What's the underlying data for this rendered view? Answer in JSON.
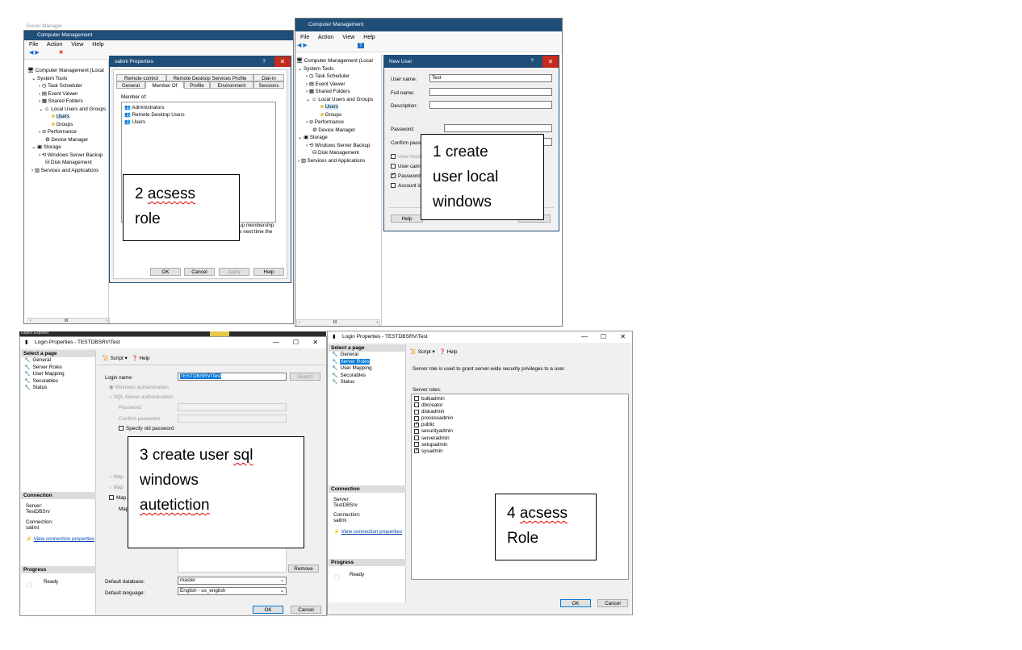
{
  "cm_left": {
    "faded_title": "Server Manager",
    "title": "Computer Management",
    "menu": [
      "File",
      "Action",
      "View",
      "Help"
    ],
    "tree": [
      "Computer Management (Local",
      "System Tools",
      "Task Scheduler",
      "Event Viewer",
      "Shared Folders",
      "Local Users and Groups",
      "Users",
      "Groups",
      "Performance",
      "Device Manager",
      "Storage",
      "Windows Server Backup",
      "Disk Management",
      "Services and Applications"
    ]
  },
  "salimi_dialog": {
    "title": "salimi Properties",
    "tabs_row1": [
      "Remote control",
      "Remote Desktop Services Profile",
      "Dial-in"
    ],
    "tabs_row2": [
      "General",
      "Member Of",
      "Profile",
      "Environment",
      "Sessions"
    ],
    "member_of_label": "Member of:",
    "members": [
      "Administrators",
      "Remote Desktop Users",
      "Users"
    ],
    "note_line1": "up membership",
    "note_line2": "e next time the",
    "buttons": [
      "OK",
      "Cancel",
      "Apply",
      "Help"
    ]
  },
  "cm_right": {
    "title": "Computer Management",
    "menu": [
      "File",
      "Action",
      "View",
      "Help"
    ],
    "tree": [
      "Computer Management (Local",
      "System Tools",
      "Task Scheduler",
      "Event Viewer",
      "Shared Folders",
      "Local Users and Groups",
      "Users",
      "Groups",
      "Performance",
      "Device Manager",
      "Storage",
      "Windows Server Backup",
      "Disk Management",
      "Services and Applications"
    ]
  },
  "new_user_dialog": {
    "title": "New User",
    "user_name_label": "User name:",
    "user_name_value": "Test",
    "full_name_label": "Full name:",
    "description_label": "Description:",
    "password_label": "Password:",
    "confirm_label": "Confirm passw",
    "checkboxes": [
      "User must c",
      "User canno",
      "Password n",
      "Account is"
    ],
    "help_button": "Help"
  },
  "callouts": {
    "c1": [
      "1 create",
      "user local",
      "windows"
    ],
    "c2_word1": "2 ",
    "c2_word2": "acsess",
    "c2_line2": "role",
    "c3_line1a": "3 create user ",
    "c3_line1b": "sql",
    "c3_line2": "windows",
    "c3_line3": "auteticti",
    "c3_line3b": "on",
    "c4_word1": "4 ",
    "c4_word2": "acsess",
    "c4_line2": "Role"
  },
  "login_left": {
    "behind_text": "Object Explorer",
    "title": "Login Properties - TESTDBSRV\\Test",
    "select_page": "Select a page",
    "pages": [
      "General",
      "Server Roles",
      "User Mapping",
      "Securables",
      "Status"
    ],
    "script_label": "Script",
    "help_label": "Help",
    "login_name_label": "Login name:",
    "login_name_value": "TESTDBSRV\\Test",
    "search_button": "Search",
    "windows_auth": "Windows authentication",
    "sql_auth": "SQL Server authentication",
    "password_label": "Password:",
    "confirm_password_label": "Confirm password:",
    "specify_old": "Specify old password",
    "map_labels": [
      "Map",
      "Map",
      "Map",
      "Map"
    ],
    "connection_head": "Connection",
    "server_label": "Server:",
    "server_value": "TestDBSrv",
    "connection_label": "Connection:",
    "connection_value": "salimi",
    "view_conn": "View connection properties",
    "progress_head": "Progress",
    "ready": "Ready",
    "remove_button": "Remove",
    "default_db_label": "Default database:",
    "default_db_value": "master",
    "default_lang_label": "Default language:",
    "default_lang_value": "English - us_english",
    "ok": "OK",
    "cancel": "Cancel"
  },
  "login_right": {
    "title": "Login Properties - TESTDBSRV\\Test",
    "select_page": "Select a page",
    "pages": [
      "General",
      "Server Roles",
      "User Mapping",
      "Securables",
      "Status"
    ],
    "script_label": "Script",
    "help_label": "Help",
    "description": "Server role is used to grant server-wide security privileges to a user.",
    "roles_label": "Server roles:",
    "roles": [
      {
        "name": "bulkadmin",
        "checked": false
      },
      {
        "name": "dbcreator",
        "checked": false
      },
      {
        "name": "diskadmin",
        "checked": false
      },
      {
        "name": "processadmin",
        "checked": false
      },
      {
        "name": "public",
        "checked": true
      },
      {
        "name": "securityadmin",
        "checked": false
      },
      {
        "name": "serveradmin",
        "checked": false
      },
      {
        "name": "setupadmin",
        "checked": false
      },
      {
        "name": "sysadmin",
        "checked": true
      }
    ],
    "connection_head": "Connection",
    "server_label": "Server:",
    "server_value": "TestDBSrv",
    "connection_label": "Connection:",
    "connection_value": "salimi",
    "view_conn": "View connection properties",
    "progress_head": "Progress",
    "ready": "Ready",
    "ok": "OK",
    "cancel": "Cancel"
  }
}
